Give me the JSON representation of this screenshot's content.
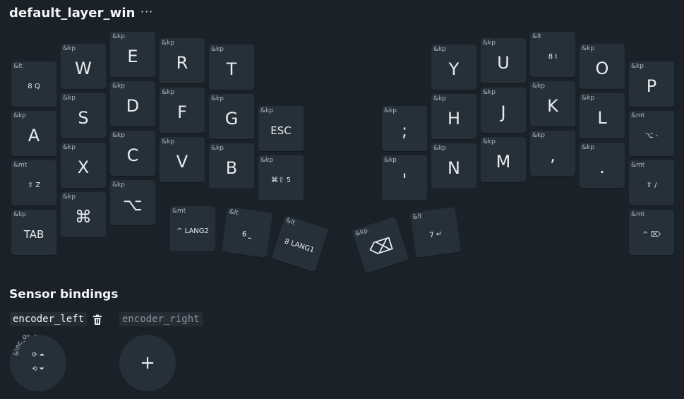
{
  "layer": {
    "name": "default_layer_win",
    "menu_label": "···"
  },
  "keys": {
    "q": {
      "behavior": "&lt",
      "label": "8 Q"
    },
    "w": {
      "behavior": "&kp",
      "label": "W"
    },
    "e": {
      "behavior": "&kp",
      "label": "E"
    },
    "r": {
      "behavior": "&kp",
      "label": "R"
    },
    "t": {
      "behavior": "&kp",
      "label": "T"
    },
    "y": {
      "behavior": "&kp",
      "label": "Y"
    },
    "u": {
      "behavior": "&kp",
      "label": "U"
    },
    "i": {
      "behavior": "&lt",
      "label": "8 I"
    },
    "o": {
      "behavior": "&kp",
      "label": "O"
    },
    "p": {
      "behavior": "&kp",
      "label": "P"
    },
    "a": {
      "behavior": "&kp",
      "label": "A"
    },
    "s": {
      "behavior": "&kp",
      "label": "S"
    },
    "d": {
      "behavior": "&kp",
      "label": "D"
    },
    "f": {
      "behavior": "&kp",
      "label": "F"
    },
    "g": {
      "behavior": "&kp",
      "label": "G"
    },
    "esc": {
      "behavior": "&kp",
      "label": "ESC"
    },
    "semi": {
      "behavior": "&kp",
      "label": ";"
    },
    "h": {
      "behavior": "&kp",
      "label": "H"
    },
    "j": {
      "behavior": "&kp",
      "label": "J"
    },
    "k": {
      "behavior": "&kp",
      "label": "K"
    },
    "l": {
      "behavior": "&kp",
      "label": "L"
    },
    "minus": {
      "behavior": "&mt",
      "label": "⌥ -"
    },
    "z": {
      "behavior": "&mt",
      "label": "⇧ Z"
    },
    "x": {
      "behavior": "&kp",
      "label": "X"
    },
    "c": {
      "behavior": "&kp",
      "label": "C"
    },
    "v": {
      "behavior": "&kp",
      "label": "V"
    },
    "b": {
      "behavior": "&kp",
      "label": "B"
    },
    "five": {
      "behavior": "&kp",
      "label": "⌘⇧ 5"
    },
    "apos": {
      "behavior": "&kp",
      "label": "'"
    },
    "n": {
      "behavior": "&kp",
      "label": "N"
    },
    "m": {
      "behavior": "&kp",
      "label": "M"
    },
    "comma": {
      "behavior": "&kp",
      "label": ","
    },
    "dot": {
      "behavior": "&kp",
      "label": "."
    },
    "slash": {
      "behavior": "&mt",
      "label": "⇧ /"
    },
    "tab": {
      "behavior": "&kp",
      "label": "TAB"
    },
    "cmd": {
      "behavior": "&kp",
      "label": "⌘"
    },
    "alt": {
      "behavior": "&kp",
      "label": "⌥"
    },
    "lang2": {
      "behavior": "&mt",
      "label": "^ LANG2"
    },
    "space": {
      "behavior": "&lt",
      "label": "6 ⎵"
    },
    "lang1": {
      "behavior": "&lt",
      "label": "8 LANG1"
    },
    "bksp": {
      "behavior": "&kp",
      "label": "⌫"
    },
    "enter": {
      "behavior": "&lt",
      "label": "7 ↵"
    },
    "del": {
      "behavior": "&mt",
      "label": "^ ⌦"
    }
  },
  "sensors": {
    "title": "Sensor bindings",
    "tabs": [
      "encoder_left",
      "encoder_right"
    ],
    "left_knob": {
      "behavior": "&inc_dec_kp",
      "cw": "⟳ ⏶",
      "ccw": "⟲ ⏷"
    },
    "add_label": "+"
  },
  "icons": {
    "trash": "trash-icon"
  }
}
